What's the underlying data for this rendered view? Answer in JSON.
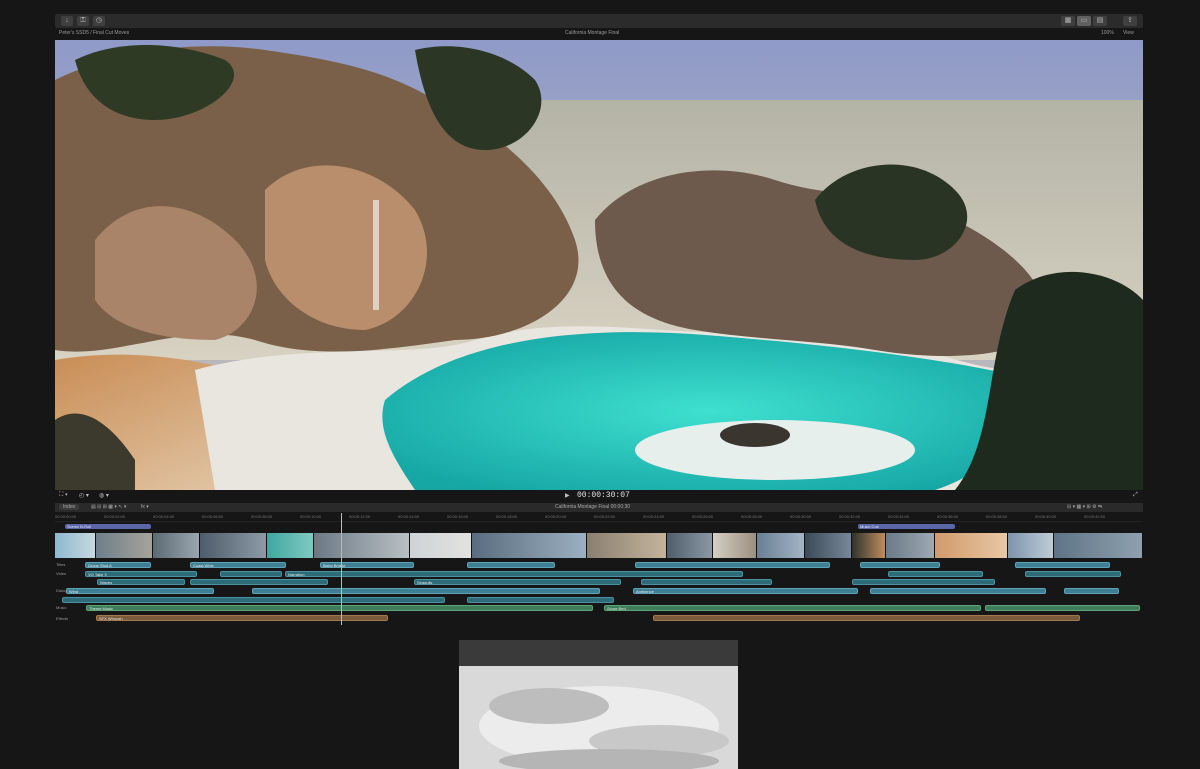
{
  "app": {
    "project_title": "California Montage Final",
    "library_label": "Peter's SSD5 / Final Cut Moves",
    "zoom": "100%",
    "view_label": "View"
  },
  "viewer": {
    "timecode": "00:00:30:07"
  },
  "timeline": {
    "index_label": "Index",
    "title_center": "California Montage Final  00:00:30",
    "ruler_ticks": [
      "00:00:00:00",
      "00:00:02:00",
      "00:00:04:00",
      "00:00:06:00",
      "00:00:08:00",
      "00:00:10:00",
      "00:00:12:00",
      "00:00:14:00",
      "00:00:16:00",
      "00:00:18:00",
      "00:00:20:00",
      "00:00:22:00",
      "00:00:24:00",
      "00:00:26:00",
      "00:00:28:00",
      "00:00:30:00",
      "00:00:32:00",
      "00:00:34:00",
      "00:00:36:00",
      "00:00:38:00",
      "00:00:40:00",
      "00:00:42:00"
    ],
    "markers": [
      {
        "label": "Scenic B-Roll"
      },
      {
        "label": "Music Cue"
      }
    ],
    "role_labels": [
      "Titles",
      "Video",
      "Dialogue",
      "Music",
      "Effects"
    ],
    "lanes": [
      {
        "label": "Drone Shot A"
      },
      {
        "label": "Coast Wide"
      },
      {
        "label": "Bixby Bridge"
      },
      {
        "label": "VO Take 3"
      },
      {
        "label": "Narration"
      },
      {
        "label": "Waves"
      },
      {
        "label": "Seagulls"
      },
      {
        "label": "Wind"
      },
      {
        "label": "Ambience"
      },
      {
        "label": "Theme Music"
      },
      {
        "label": "Score Bed"
      },
      {
        "label": "SFX Whoosh"
      }
    ]
  },
  "colors": {
    "background": "#161616",
    "timeline_blue": "#3f7f94",
    "marker_purple": "#5a66a8"
  },
  "icons": [
    "import-icon",
    "keyword-icon",
    "background-tasks-icon",
    "browser-toggle-icon",
    "viewer-toggle-icon",
    "inspector-toggle-icon",
    "share-icon",
    "transform-icon",
    "speed-icon",
    "fullscreen-icon",
    "play-icon"
  ]
}
